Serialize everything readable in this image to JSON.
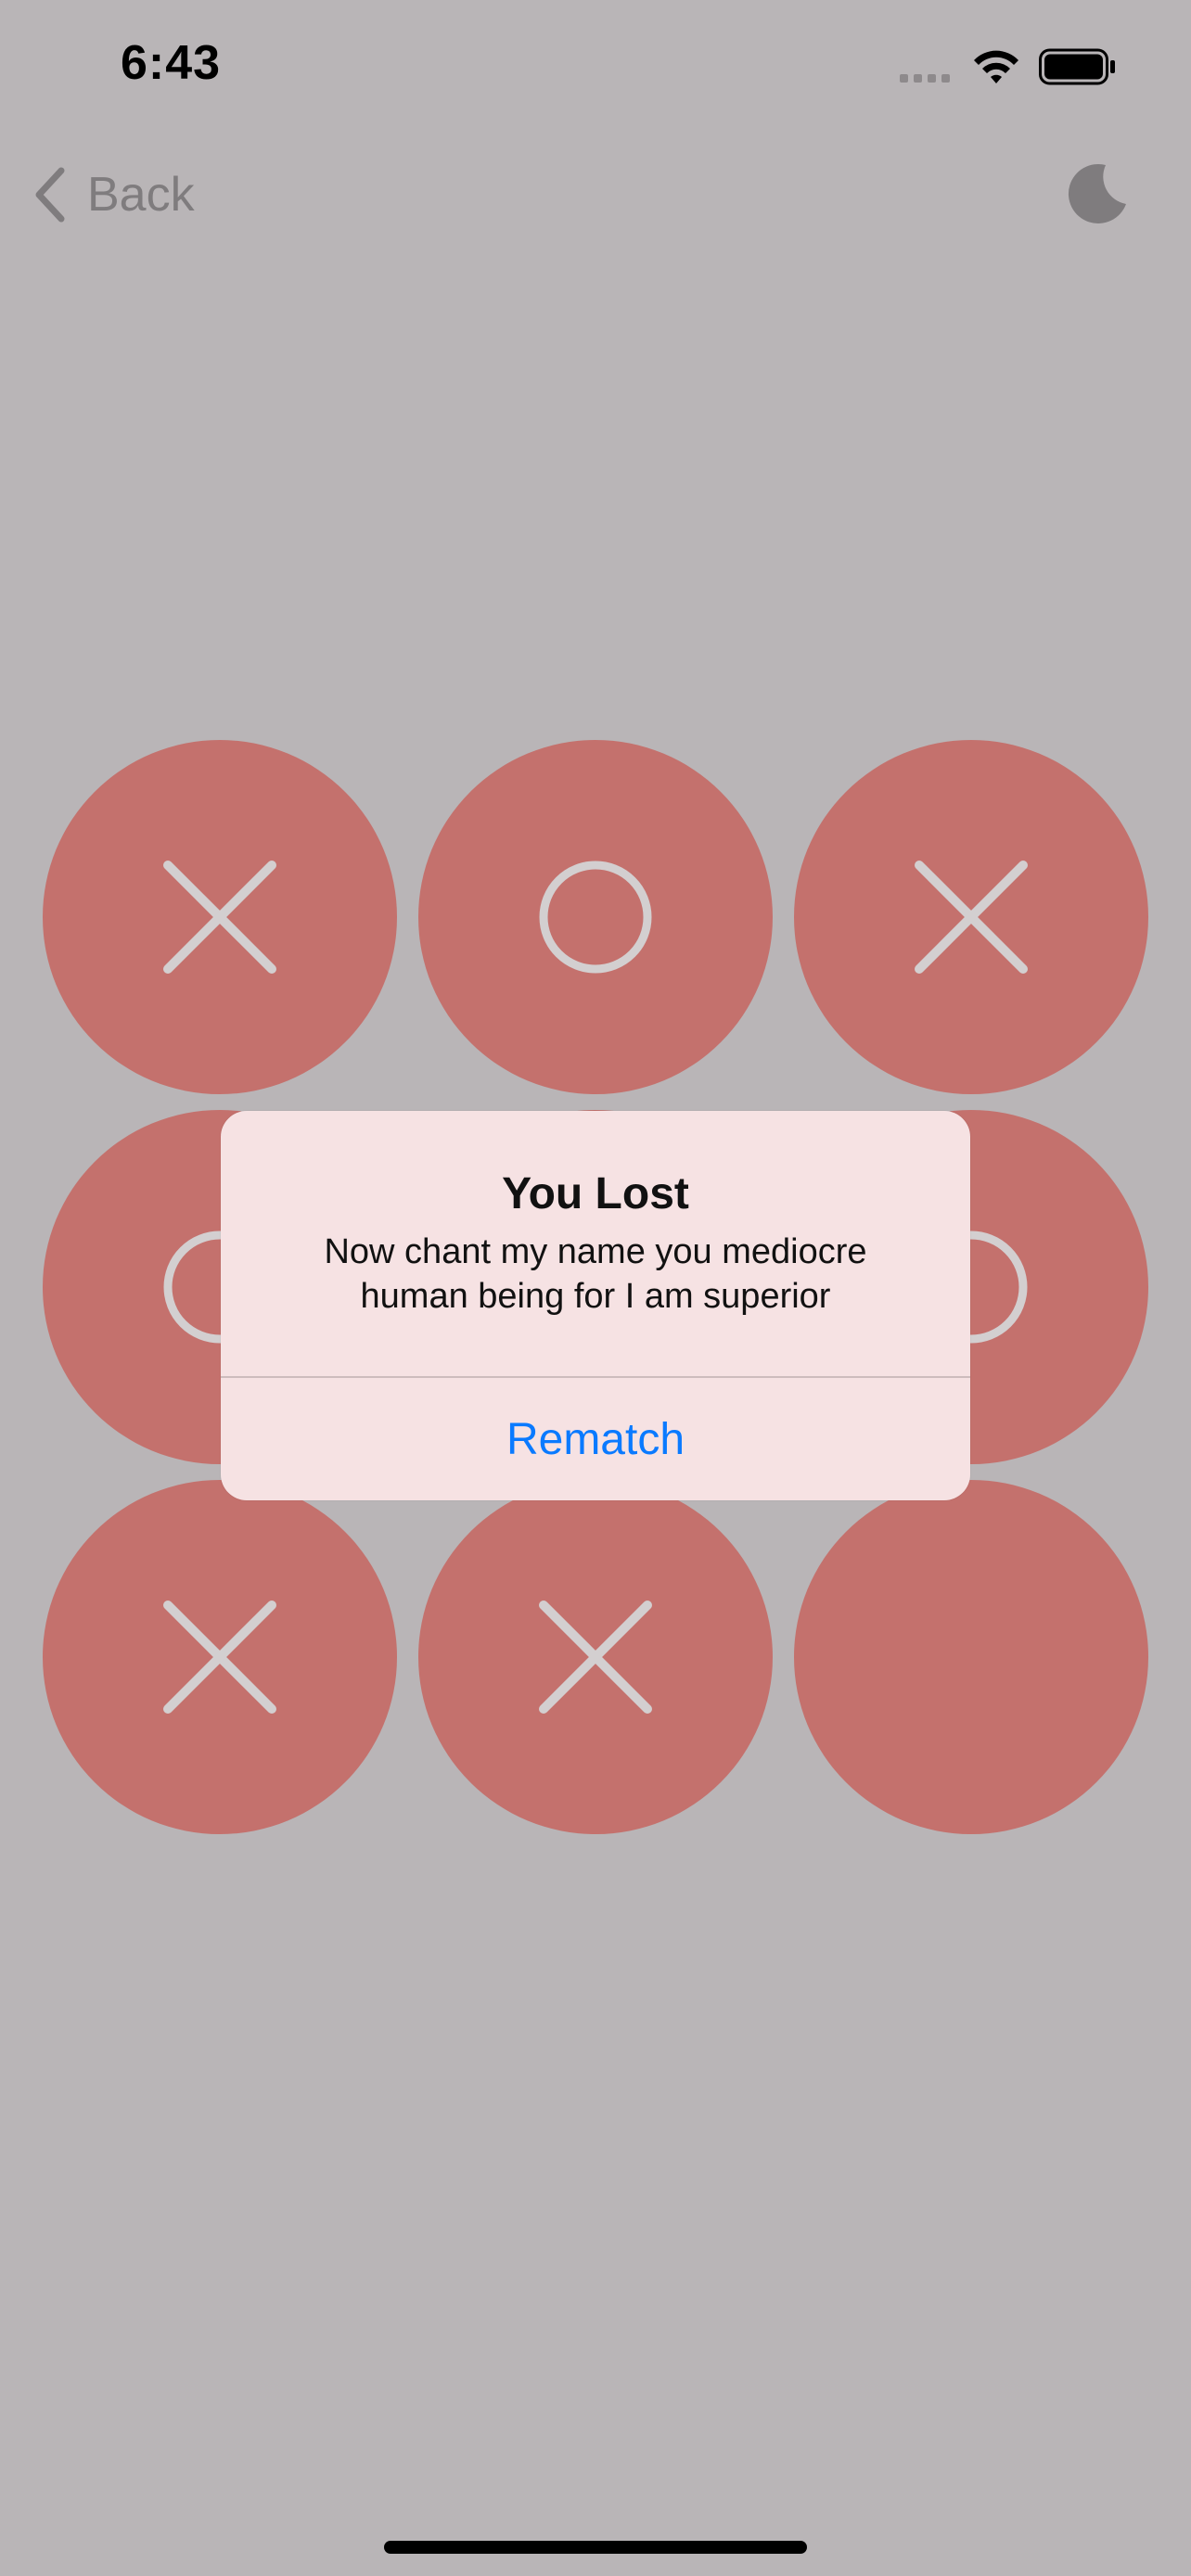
{
  "status_bar": {
    "time": "6:43"
  },
  "nav": {
    "back_label": "Back"
  },
  "board": {
    "cells": [
      "X",
      "O",
      "X",
      "O",
      "",
      "O",
      "X",
      "X",
      ""
    ]
  },
  "alert": {
    "title": "You Lost",
    "message": "Now chant my name you mediocre human being for I am superior",
    "button_label": "Rematch"
  },
  "colors": {
    "background": "#b9b5b7",
    "cell": "#c4716d",
    "mark": "#d3cfd0",
    "alert_bg": "#f6e2e3",
    "accent": "#0a7aff"
  },
  "icons": {
    "back": "chevron-left-icon",
    "theme": "moon-icon",
    "wifi": "wifi-icon",
    "battery": "battery-icon",
    "signal": "signal-icon"
  }
}
